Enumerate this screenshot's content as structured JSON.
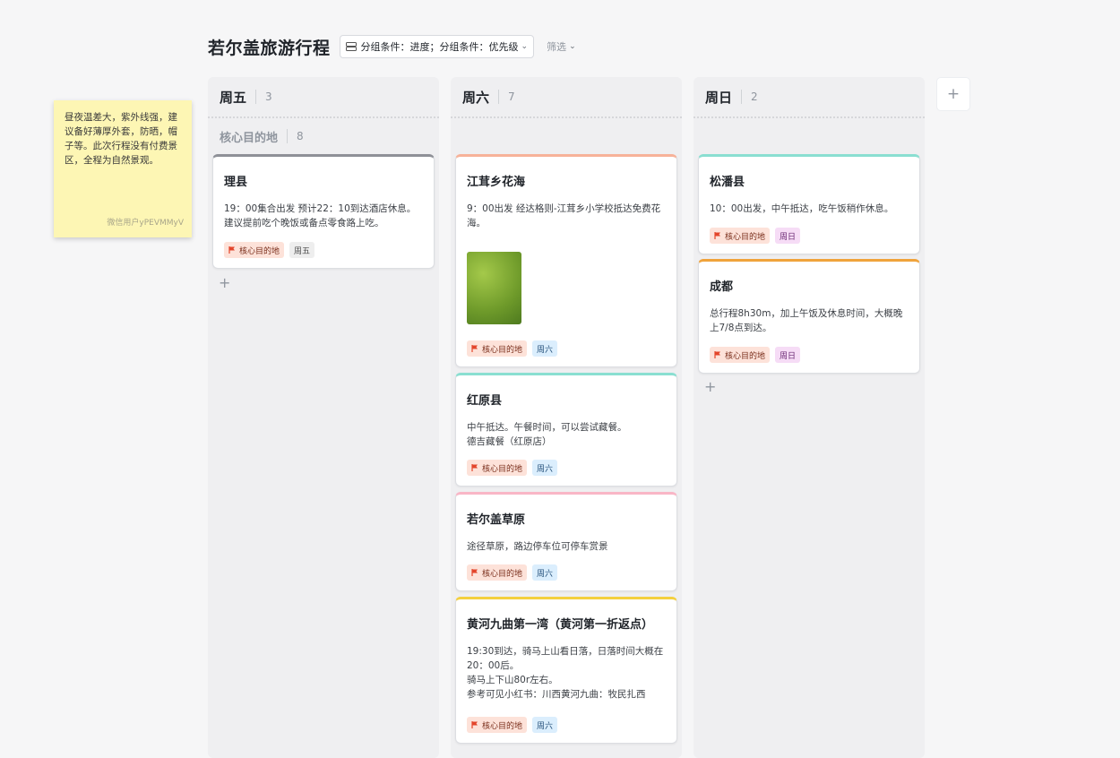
{
  "header": {
    "title": "若尔盖旅游行程",
    "group_label": "分组条件：进度；分组条件：优先级",
    "filter_label": "筛选"
  },
  "sticky": {
    "text": "昼夜温差大，紫外线强，建议备好薄厚外套，防晒，帽子等。此次行程没有付费景区，全程为自然景观。",
    "author": "微信用户yPEVMMyV"
  },
  "colors": {
    "grey": "#8e9097",
    "salmon": "#f7b299",
    "teal": "#8adfd1",
    "pink": "#f9b6c6",
    "yellow": "#f4d03f",
    "orange": "#f0a33b"
  },
  "columns": [
    {
      "title": "周五",
      "count": "3",
      "subgroup": {
        "label": "核心目的地",
        "count": "8"
      },
      "cards": [
        {
          "title": "理县",
          "body": "19：00集合出发 预计22：10到达酒店休息。\n建议提前吃个晚饭或备点零食路上吃。",
          "tags": [
            "核心目的地",
            "周五"
          ]
        }
      ]
    },
    {
      "title": "周六",
      "count": "7",
      "cards": [
        {
          "title": "江茸乡花海",
          "body": "9：00出发 经达格则-江茸乡小学校抵达免费花海。",
          "image": "grassland-photo",
          "tags": [
            "核心目的地",
            "周六"
          ]
        },
        {
          "title": "红原县",
          "body": "中午抵达。午餐时间，可以尝试藏餐。\n德吉藏餐（红原店）",
          "tags": [
            "核心目的地",
            "周六"
          ]
        },
        {
          "title": "若尔盖草原",
          "body": "途径草原，路边停车位可停车赏景",
          "tags": [
            "核心目的地",
            "周六"
          ]
        },
        {
          "title": "黄河九曲第一湾（黄河第一折返点）",
          "body": "19:30到达，骑马上山看日落，日落时间大概在20：00后。\n骑马上下山80r左右。\n参考可见小红书：川西黄河九曲：牧民扎西",
          "tags": [
            "核心目的地",
            "周六"
          ]
        }
      ]
    },
    {
      "title": "周日",
      "count": "2",
      "cards": [
        {
          "title": "松潘县",
          "body": "10：00出发，中午抵达，吃午饭稍作休息。",
          "tags": [
            "核心目的地",
            "周日"
          ]
        },
        {
          "title": "成都",
          "body": "总行程8h30m，加上午饭及休息时间，大概晚上7/8点到达。",
          "tags": [
            "核心目的地",
            "周日"
          ]
        }
      ]
    }
  ],
  "add_icon": "+"
}
